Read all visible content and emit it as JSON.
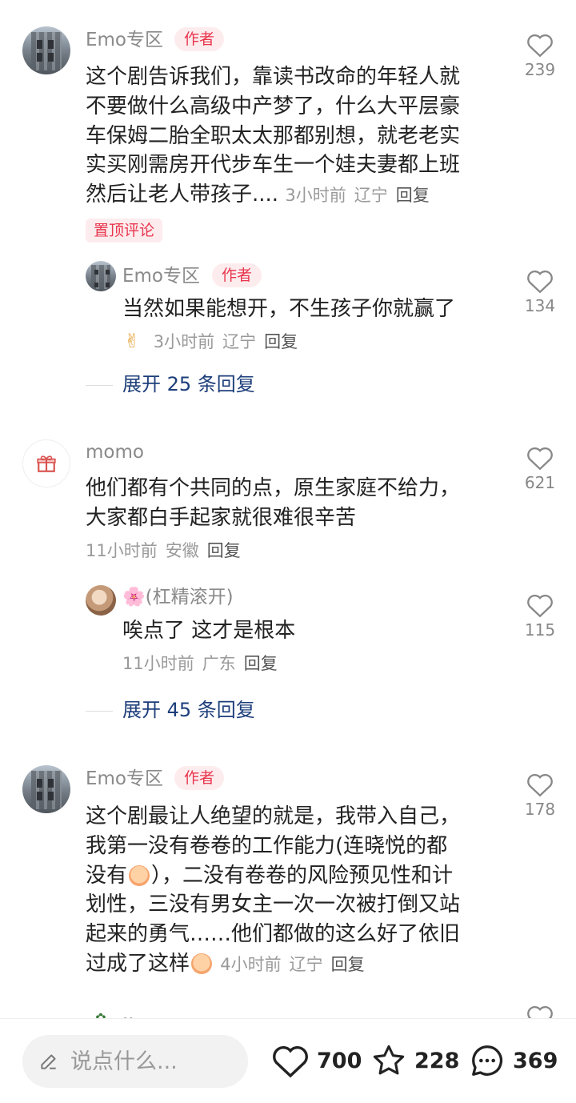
{
  "comments": [
    {
      "username": "Emo专区",
      "author_tag": "作者",
      "lines": [
        "这个剧告诉我们，靠读书改命的年轻人就",
        "不要做什么高级中产梦了，什么大平层豪",
        "车保姆二胎全职太太那都别想，就老老实",
        "实买刚需房开代步车生一个娃夫妻都上班",
        "然后让老人带孩子...."
      ],
      "time": "3小时前",
      "location": "辽宁",
      "reply": "回复",
      "pin_tag": "置顶评论",
      "likes": "239",
      "replies": [
        {
          "username": "Emo专区",
          "author_tag": "作者",
          "text": "当然如果能想开，不生孩子你就赢了",
          "time": "3小时前",
          "location": "辽宁",
          "reply": "回复",
          "likes": "134"
        }
      ],
      "expand": "展开 25 条回复"
    },
    {
      "username": "momo",
      "lines": [
        "他们都有个共同的点，原生家庭不给力，",
        "大家都白手起家就很难很辛苦"
      ],
      "time": "11小时前",
      "location": "安徽",
      "reply": "回复",
      "likes": "621",
      "replies": [
        {
          "username": "🌸(杠精滚开)",
          "text": "唉点了 这才是根本",
          "time": "11小时前",
          "location": "广东",
          "reply": "回复",
          "likes": "115"
        }
      ],
      "expand": "展开 45 条回复"
    },
    {
      "username": "Emo专区",
      "author_tag": "作者",
      "lines": [
        "这个剧最让人绝望的就是，我带入自己，",
        "我第一没有卷卷的工作能力(连晓悦的都",
        "没有",
        "），二没有卷卷的风险预见性和计",
        "划性，三没有男女主一次一次被打倒又站",
        "起来的勇气……他们都做的这么好了依旧",
        "过成了这样"
      ],
      "time": "4小时前",
      "location": "辽宁",
      "reply": "回复",
      "likes": "178"
    }
  ],
  "partial_next": {
    "username": ".."
  },
  "bottom_bar": {
    "input_placeholder": "说点什么...",
    "likes": "700",
    "favorites": "228",
    "comments": "369"
  },
  "colors": {
    "accent_red": "#e8354d",
    "tag_bg": "#fdecee",
    "expand_blue": "#1d3e7a",
    "muted_text": "#9a9a9a"
  },
  "icons": [
    "heart-icon",
    "star-icon",
    "comment-bubble-icon",
    "pencil-icon",
    "gift-icon",
    "cry-emoji-icon",
    "victory-hand-icon"
  ]
}
